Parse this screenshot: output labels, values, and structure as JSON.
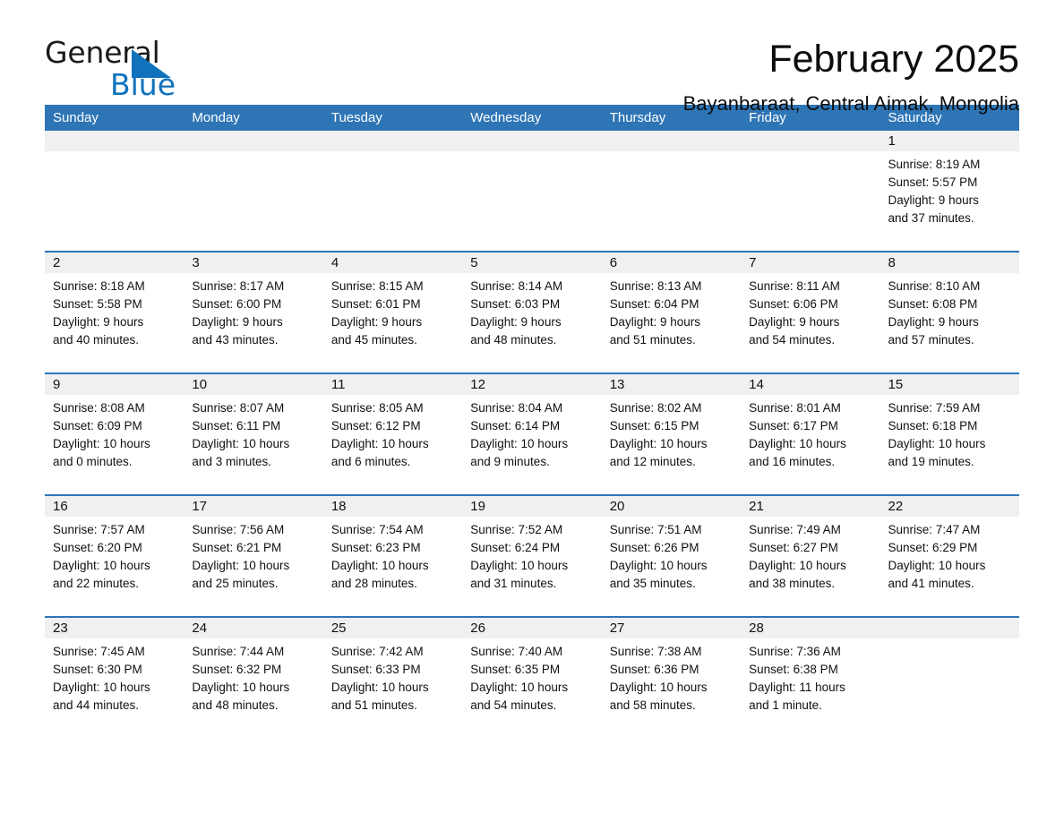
{
  "logo": {
    "word_one": "General",
    "word_two": "Blue",
    "triangle_color": "#1072bb",
    "text_color": "#1a1a1a"
  },
  "header": {
    "title": "February 2025",
    "subtitle": "Bayanbaraat, Central Aimak, Mongolia"
  },
  "theme": {
    "header_blue": "#2e75b6",
    "daynum_band": "#f0f0f0",
    "rule_blue": "#2e75b6",
    "text": "#111111"
  },
  "calendar": {
    "weekdays": [
      "Sunday",
      "Monday",
      "Tuesday",
      "Wednesday",
      "Thursday",
      "Friday",
      "Saturday"
    ],
    "weeks": [
      [
        {
          "day": "",
          "lines": []
        },
        {
          "day": "",
          "lines": []
        },
        {
          "day": "",
          "lines": []
        },
        {
          "day": "",
          "lines": []
        },
        {
          "day": "",
          "lines": []
        },
        {
          "day": "",
          "lines": []
        },
        {
          "day": "1",
          "lines": [
            "Sunrise: 8:19 AM",
            "Sunset: 5:57 PM",
            "Daylight: 9 hours",
            "and 37 minutes."
          ]
        }
      ],
      [
        {
          "day": "2",
          "lines": [
            "Sunrise: 8:18 AM",
            "Sunset: 5:58 PM",
            "Daylight: 9 hours",
            "and 40 minutes."
          ]
        },
        {
          "day": "3",
          "lines": [
            "Sunrise: 8:17 AM",
            "Sunset: 6:00 PM",
            "Daylight: 9 hours",
            "and 43 minutes."
          ]
        },
        {
          "day": "4",
          "lines": [
            "Sunrise: 8:15 AM",
            "Sunset: 6:01 PM",
            "Daylight: 9 hours",
            "and 45 minutes."
          ]
        },
        {
          "day": "5",
          "lines": [
            "Sunrise: 8:14 AM",
            "Sunset: 6:03 PM",
            "Daylight: 9 hours",
            "and 48 minutes."
          ]
        },
        {
          "day": "6",
          "lines": [
            "Sunrise: 8:13 AM",
            "Sunset: 6:04 PM",
            "Daylight: 9 hours",
            "and 51 minutes."
          ]
        },
        {
          "day": "7",
          "lines": [
            "Sunrise: 8:11 AM",
            "Sunset: 6:06 PM",
            "Daylight: 9 hours",
            "and 54 minutes."
          ]
        },
        {
          "day": "8",
          "lines": [
            "Sunrise: 8:10 AM",
            "Sunset: 6:08 PM",
            "Daylight: 9 hours",
            "and 57 minutes."
          ]
        }
      ],
      [
        {
          "day": "9",
          "lines": [
            "Sunrise: 8:08 AM",
            "Sunset: 6:09 PM",
            "Daylight: 10 hours",
            "and 0 minutes."
          ]
        },
        {
          "day": "10",
          "lines": [
            "Sunrise: 8:07 AM",
            "Sunset: 6:11 PM",
            "Daylight: 10 hours",
            "and 3 minutes."
          ]
        },
        {
          "day": "11",
          "lines": [
            "Sunrise: 8:05 AM",
            "Sunset: 6:12 PM",
            "Daylight: 10 hours",
            "and 6 minutes."
          ]
        },
        {
          "day": "12",
          "lines": [
            "Sunrise: 8:04 AM",
            "Sunset: 6:14 PM",
            "Daylight: 10 hours",
            "and 9 minutes."
          ]
        },
        {
          "day": "13",
          "lines": [
            "Sunrise: 8:02 AM",
            "Sunset: 6:15 PM",
            "Daylight: 10 hours",
            "and 12 minutes."
          ]
        },
        {
          "day": "14",
          "lines": [
            "Sunrise: 8:01 AM",
            "Sunset: 6:17 PM",
            "Daylight: 10 hours",
            "and 16 minutes."
          ]
        },
        {
          "day": "15",
          "lines": [
            "Sunrise: 7:59 AM",
            "Sunset: 6:18 PM",
            "Daylight: 10 hours",
            "and 19 minutes."
          ]
        }
      ],
      [
        {
          "day": "16",
          "lines": [
            "Sunrise: 7:57 AM",
            "Sunset: 6:20 PM",
            "Daylight: 10 hours",
            "and 22 minutes."
          ]
        },
        {
          "day": "17",
          "lines": [
            "Sunrise: 7:56 AM",
            "Sunset: 6:21 PM",
            "Daylight: 10 hours",
            "and 25 minutes."
          ]
        },
        {
          "day": "18",
          "lines": [
            "Sunrise: 7:54 AM",
            "Sunset: 6:23 PM",
            "Daylight: 10 hours",
            "and 28 minutes."
          ]
        },
        {
          "day": "19",
          "lines": [
            "Sunrise: 7:52 AM",
            "Sunset: 6:24 PM",
            "Daylight: 10 hours",
            "and 31 minutes."
          ]
        },
        {
          "day": "20",
          "lines": [
            "Sunrise: 7:51 AM",
            "Sunset: 6:26 PM",
            "Daylight: 10 hours",
            "and 35 minutes."
          ]
        },
        {
          "day": "21",
          "lines": [
            "Sunrise: 7:49 AM",
            "Sunset: 6:27 PM",
            "Daylight: 10 hours",
            "and 38 minutes."
          ]
        },
        {
          "day": "22",
          "lines": [
            "Sunrise: 7:47 AM",
            "Sunset: 6:29 PM",
            "Daylight: 10 hours",
            "and 41 minutes."
          ]
        }
      ],
      [
        {
          "day": "23",
          "lines": [
            "Sunrise: 7:45 AM",
            "Sunset: 6:30 PM",
            "Daylight: 10 hours",
            "and 44 minutes."
          ]
        },
        {
          "day": "24",
          "lines": [
            "Sunrise: 7:44 AM",
            "Sunset: 6:32 PM",
            "Daylight: 10 hours",
            "and 48 minutes."
          ]
        },
        {
          "day": "25",
          "lines": [
            "Sunrise: 7:42 AM",
            "Sunset: 6:33 PM",
            "Daylight: 10 hours",
            "and 51 minutes."
          ]
        },
        {
          "day": "26",
          "lines": [
            "Sunrise: 7:40 AM",
            "Sunset: 6:35 PM",
            "Daylight: 10 hours",
            "and 54 minutes."
          ]
        },
        {
          "day": "27",
          "lines": [
            "Sunrise: 7:38 AM",
            "Sunset: 6:36 PM",
            "Daylight: 10 hours",
            "and 58 minutes."
          ]
        },
        {
          "day": "28",
          "lines": [
            "Sunrise: 7:36 AM",
            "Sunset: 6:38 PM",
            "Daylight: 11 hours",
            "and 1 minute."
          ]
        },
        {
          "day": "",
          "lines": []
        }
      ]
    ]
  }
}
